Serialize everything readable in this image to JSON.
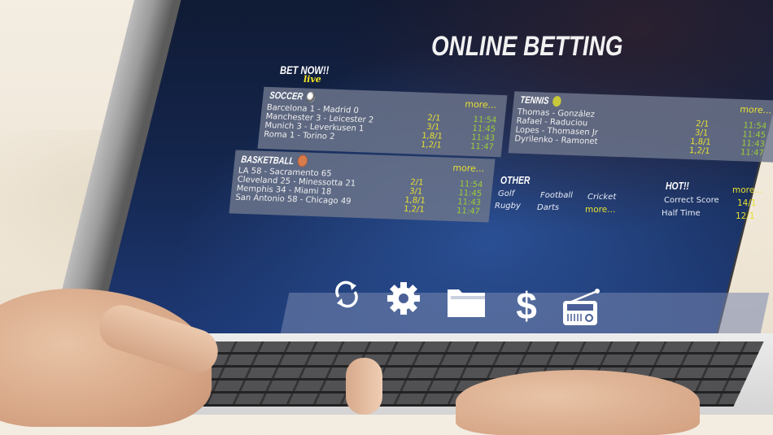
{
  "screen": {
    "title": "ONLINE BETTING",
    "bet_now": "BET NOW!!",
    "live_label": "live",
    "colors": {
      "accent_yellow": "#e6e030",
      "time_green": "#9ccc3a",
      "panel_bg": "#6e768c",
      "screen_bg": "#14254b"
    },
    "sections": {
      "soccer": {
        "title": "SOCCER",
        "icon": "soccer-ball-icon",
        "more": "more...",
        "rows": [
          {
            "match": "Barcelona 1 - Madrid 0",
            "odds": "2/1",
            "time": "11:54"
          },
          {
            "match": "Manchester 3 - Leicester 2",
            "odds": "3/1",
            "time": "11:45"
          },
          {
            "match": "Munich 3 - Leverkusen 1",
            "odds": "1,8/1",
            "time": "11:43"
          },
          {
            "match": "Roma 1 - Torino 2",
            "odds": "1,2/1",
            "time": "11:47"
          }
        ]
      },
      "tennis": {
        "title": "TENNIS",
        "icon": "tennis-ball-icon",
        "more": "more...",
        "rows": [
          {
            "match": "Thomas - González",
            "odds": "2/1",
            "time": "11:54"
          },
          {
            "match": "Rafael - Raduciou",
            "odds": "3/1",
            "time": "11:45"
          },
          {
            "match": "Lopes - Thomasen Jr",
            "odds": "1,8/1",
            "time": "11:43"
          },
          {
            "match": "Dyrilenko - Ramonet",
            "odds": "1,2/1",
            "time": "11:47"
          }
        ]
      },
      "basketball": {
        "title": "BASKETBALL",
        "icon": "basketball-icon",
        "more": "more...",
        "rows": [
          {
            "match": "LA 58 - Sacramento 65",
            "odds": "2/1",
            "time": "11:54"
          },
          {
            "match": "Cleveland 25 - Minessotta 21",
            "odds": "3/1",
            "time": "11:45"
          },
          {
            "match": "Memphis 34 - Miami 18",
            "odds": "1,8/1",
            "time": "11:43"
          },
          {
            "match": "San Antonio 58 - Chicago 49",
            "odds": "1,2/1",
            "time": "11:47"
          }
        ]
      },
      "other": {
        "title": "OTHER",
        "items": [
          "Golf",
          "Football",
          "Cricket",
          "Rugby",
          "Darts"
        ],
        "more": "more..."
      },
      "hot": {
        "title": "HOT!!",
        "more": "more...",
        "rows": [
          {
            "label": "Correct Score",
            "odds": "14/1"
          },
          {
            "label": "Half Time",
            "odds": "12/1"
          }
        ]
      }
    },
    "toolbar": {
      "icons": [
        "refresh-icon",
        "gear-icon",
        "folder-icon",
        "dollar-icon",
        "radio-icon"
      ]
    }
  }
}
